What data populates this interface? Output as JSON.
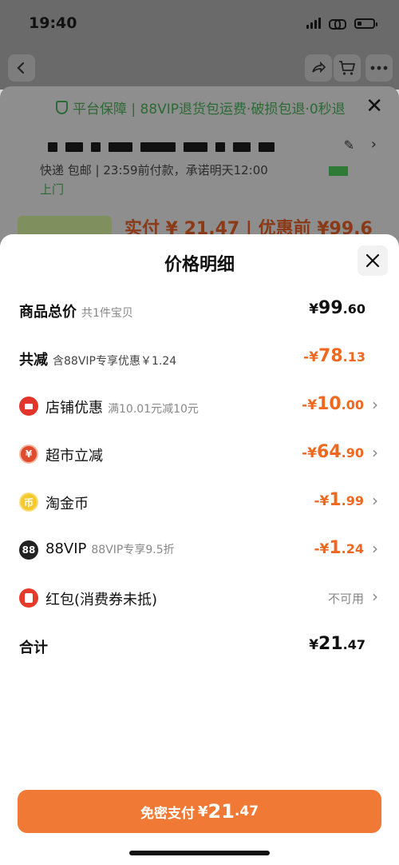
{
  "status_bar": {
    "time": "19:40"
  },
  "background": {
    "guarantee": "平台保障 | 88VIP退货包运费·破损包退·0秒退",
    "delivery": "快递 包邮 | 23:59前付款，承诺明天12:00",
    "shangmen": "上门",
    "pay_preview": "实付 ¥ 21.47 | 优惠前 ¥99.6"
  },
  "sheet": {
    "title": "价格明细",
    "rows": [
      {
        "label": "商品总价",
        "sub": "共1件宝贝",
        "cur": "¥",
        "int": "99",
        "dec": ".60"
      },
      {
        "label": "共减",
        "sub": "含88VIP专享优惠￥1.24",
        "cur": "-¥",
        "int": "78",
        "dec": ".13"
      },
      {
        "label": "店铺优惠",
        "sub": "满10.01元减10元",
        "icon": "store-icon",
        "cur": "-¥",
        "int": "10",
        "dec": ".00"
      },
      {
        "label": "超市立减",
        "icon": "supermarket-icon",
        "cur": "-¥",
        "int": "64",
        "dec": ".90"
      },
      {
        "label": "淘金币",
        "icon": "gold-coin-icon",
        "cur": "-¥",
        "int": "1",
        "dec": ".99"
      },
      {
        "label": "88VIP",
        "sub": "88VIP专享9.5折",
        "icon": "88vip-icon",
        "icon_text": "88",
        "cur": "-¥",
        "int": "1",
        "dec": ".24"
      },
      {
        "label": "红包(消费券未抵)",
        "icon": "red-packet-icon",
        "status": "不可用"
      },
      {
        "label": "合计",
        "cur": "¥",
        "int": "21",
        "dec": ".47"
      }
    ]
  },
  "pay_button": {
    "label": "免密支付",
    "cur": "¥",
    "int": "21",
    "dec": ".47"
  },
  "colors": {
    "accent": "#f07a35",
    "discount": "#f06820",
    "text": "#111111",
    "muted": "#888888"
  }
}
